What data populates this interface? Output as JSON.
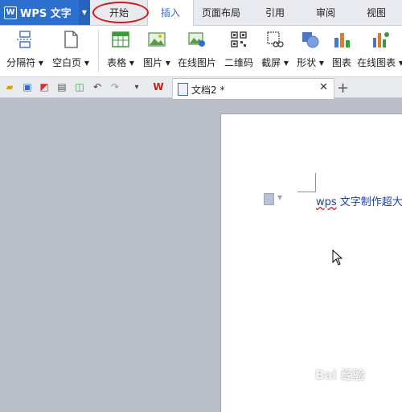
{
  "app": {
    "logo": "W",
    "name": "WPS 文字"
  },
  "tabs": [
    "开始",
    "插入",
    "页面布局",
    "引用",
    "审阅",
    "视图"
  ],
  "active_tab": "插入",
  "ribbon": {
    "page_break": "分隔符",
    "blank_page": "空白页",
    "table": "表格",
    "picture": "图片",
    "online_picture": "在线图片",
    "qrcode": "二维码",
    "screenshot": "截屏",
    "shape": "形状",
    "chart": "图表",
    "online_chart": "在线图表"
  },
  "document": {
    "tab_name": "文档2 *",
    "text_prefix": "wps",
    "text_rest": " 文字制作超大"
  },
  "watermark": "Bai 经验",
  "colors": {
    "accent": "#2d6fcf",
    "highlight_circle": "#d7141a"
  }
}
